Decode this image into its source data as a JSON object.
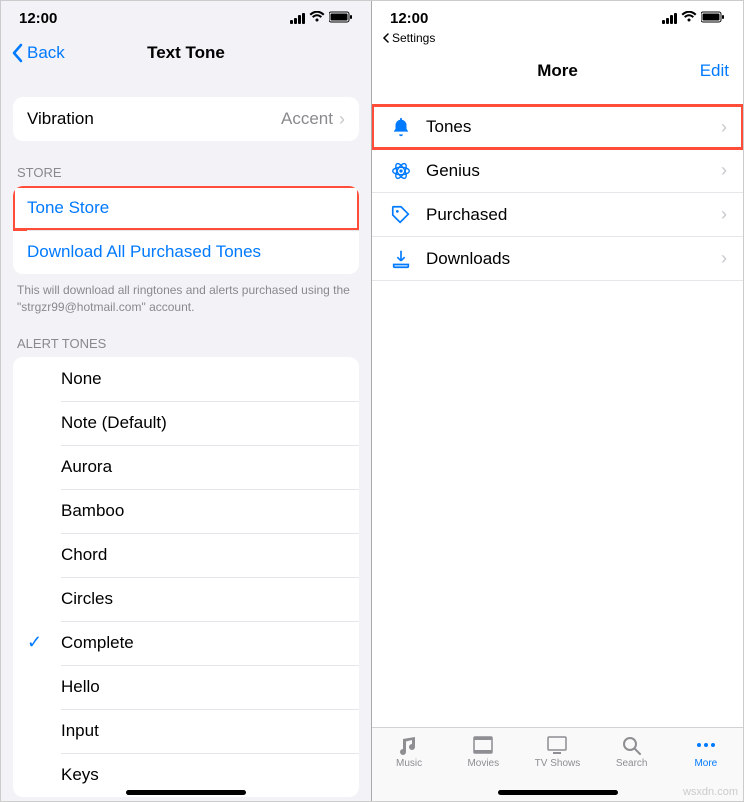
{
  "status": {
    "time": "12:00"
  },
  "left": {
    "nav": {
      "back": "Back",
      "title": "Text Tone"
    },
    "vibration": {
      "label": "Vibration",
      "value": "Accent"
    },
    "store": {
      "header": "STORE",
      "tone_store": "Tone Store",
      "download_all": "Download All Purchased Tones",
      "footer": "This will download all ringtones and alerts purchased using the \"strgzr99@hotmail.com\" account."
    },
    "alert_tones": {
      "header": "ALERT TONES",
      "selected": "Complete",
      "items": [
        "None",
        "Note (Default)",
        "Aurora",
        "Bamboo",
        "Chord",
        "Circles",
        "Complete",
        "Hello",
        "Input",
        "Keys"
      ]
    }
  },
  "right": {
    "breadcrumb": "Settings",
    "nav": {
      "title": "More",
      "edit": "Edit"
    },
    "items": [
      {
        "icon": "bell",
        "label": "Tones",
        "highlight": true
      },
      {
        "icon": "atom",
        "label": "Genius"
      },
      {
        "icon": "tag",
        "label": "Purchased"
      },
      {
        "icon": "download",
        "label": "Downloads"
      }
    ],
    "tabs": [
      {
        "icon": "music",
        "label": "Music"
      },
      {
        "icon": "film",
        "label": "Movies"
      },
      {
        "icon": "tv",
        "label": "TV Shows"
      },
      {
        "icon": "search",
        "label": "Search"
      },
      {
        "icon": "more",
        "label": "More",
        "active": true
      }
    ]
  },
  "watermark": "wsxdn.com"
}
